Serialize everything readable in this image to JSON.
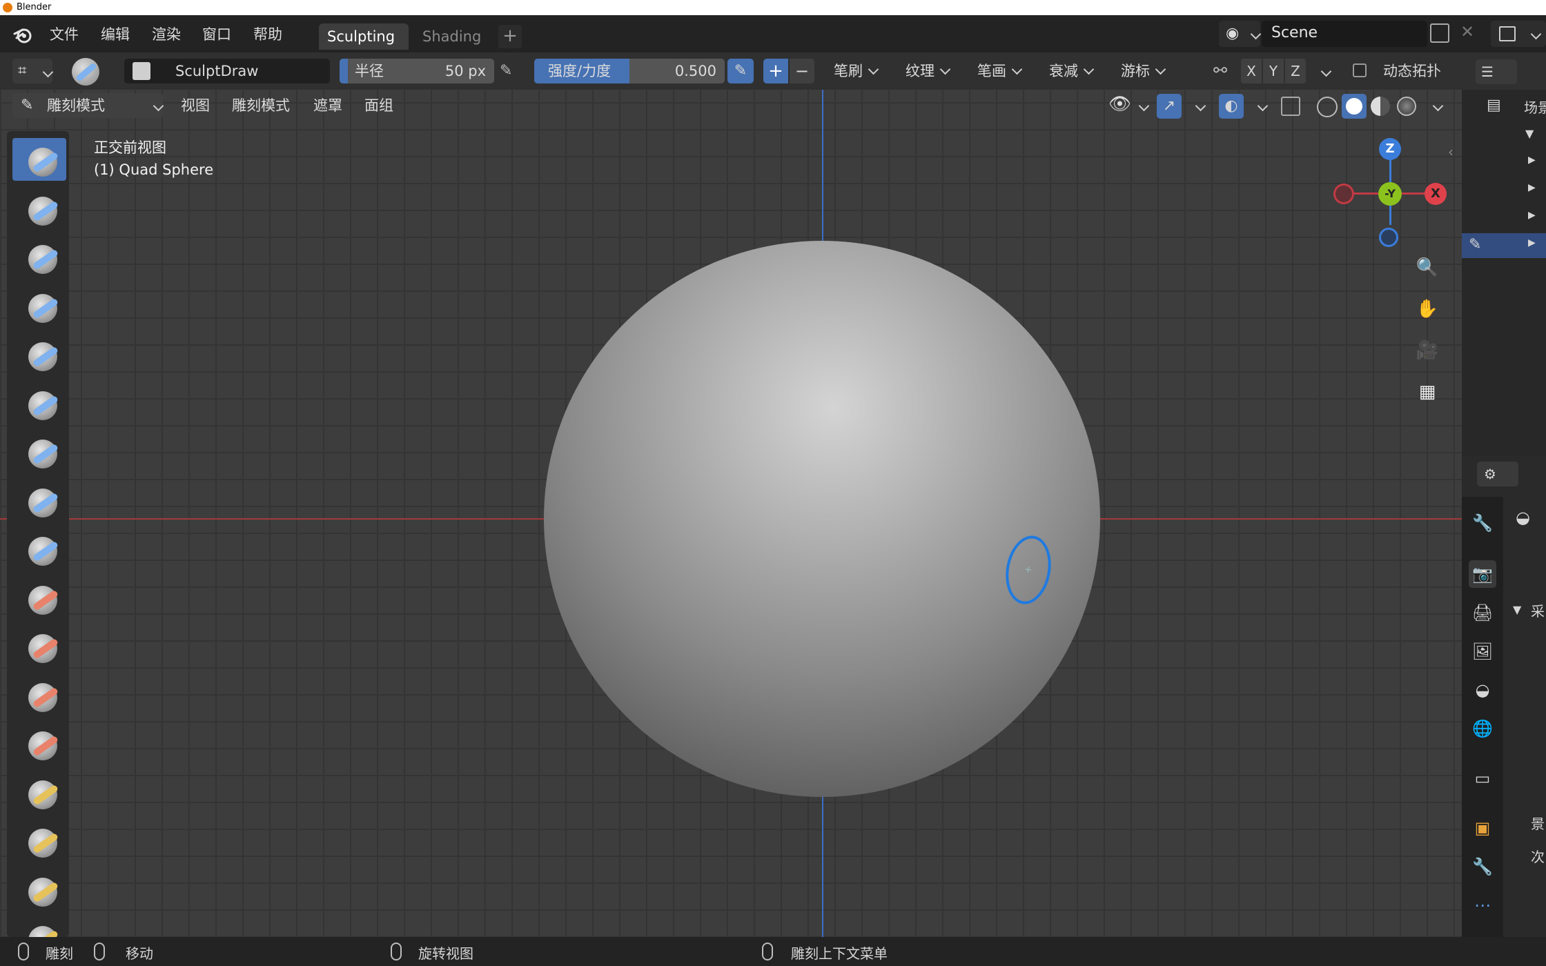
{
  "window": {
    "title": "Blender"
  },
  "menu": {
    "items": [
      "文件",
      "编辑",
      "渲染",
      "窗口",
      "帮助"
    ],
    "workspace_tabs": [
      "Sculpting",
      "Shading"
    ],
    "active_tab": "Sculpting",
    "add_tab": "+",
    "scene_name": "Scene"
  },
  "tool_header": {
    "brush_name": "SculptDraw",
    "radius_label": "半径",
    "radius_value": "50 px",
    "strength_label": "强度/力度",
    "strength_value": "0.500",
    "direction_add": "+",
    "direction_sub": "−",
    "dropdowns": [
      "笔刷",
      "纹理",
      "笔画",
      "衰减",
      "游标"
    ],
    "symmetry": [
      "X",
      "Y",
      "Z"
    ],
    "dyntopo_label": "动态拓扑"
  },
  "mode_header": {
    "mode": "雕刻模式",
    "menus": [
      "视图",
      "雕刻模式",
      "遮罩",
      "面组"
    ]
  },
  "viewport": {
    "view_name": "正交前视图",
    "object_name": "(1) Quad Sphere",
    "gizmo": {
      "z": "Z",
      "y": "-Y",
      "x": "X"
    }
  },
  "outliner": {
    "title_partial": "场景"
  },
  "properties": {
    "partial_labels": [
      "采",
      "景",
      "次"
    ]
  },
  "status_bar": {
    "left_action": "雕刻",
    "middle_action": "移动",
    "rotate_action": "旋转视图",
    "context_action": "雕刻上下文菜单"
  },
  "colors": {
    "accent": "#4772b3",
    "axis_x": "#e0424b",
    "axis_y": "#8cc21e",
    "axis_z": "#3b7ddb",
    "brush_cursor": "#1f7ae0"
  },
  "tools": [
    {
      "icon": "sculpt-draw-icon",
      "stroke": "#7fb2ee"
    },
    {
      "icon": "draw-sharp-icon",
      "stroke": "#7fb2ee"
    },
    {
      "icon": "clay-icon",
      "stroke": "#7fb2ee"
    },
    {
      "icon": "clay-strips-icon",
      "stroke": "#7fb2ee"
    },
    {
      "icon": "clay-thumb-icon",
      "stroke": "#7fb2ee"
    },
    {
      "icon": "layer-icon",
      "stroke": "#7fb2ee"
    },
    {
      "icon": "inflate-icon",
      "stroke": "#7fb2ee"
    },
    {
      "icon": "blob-icon",
      "stroke": "#7fb2ee"
    },
    {
      "icon": "crease-icon",
      "stroke": "#7fb2ee"
    },
    {
      "icon": "smooth-icon",
      "stroke": "#e8826a"
    },
    {
      "icon": "flatten-icon",
      "stroke": "#e8826a"
    },
    {
      "icon": "fill-icon",
      "stroke": "#e8826a"
    },
    {
      "icon": "scrape-icon",
      "stroke": "#e8826a"
    },
    {
      "icon": "multiplane-scrape-icon",
      "stroke": "#e6c25a"
    },
    {
      "icon": "pinch-icon",
      "stroke": "#e6c25a"
    },
    {
      "icon": "grab-icon",
      "stroke": "#e6c25a"
    },
    {
      "icon": "elastic-deform-icon",
      "stroke": "#e6c25a"
    }
  ]
}
